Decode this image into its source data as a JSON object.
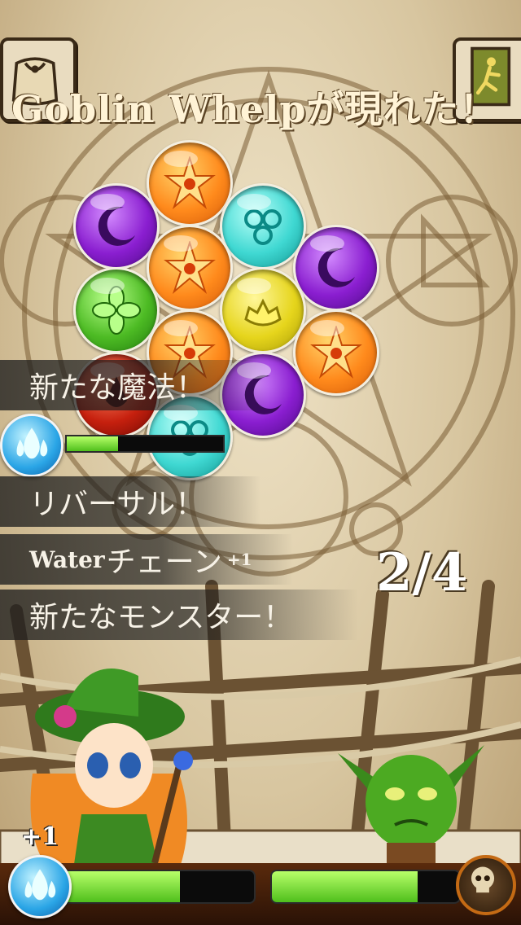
{
  "header": {
    "title": "Goblin Whelpが現れた！",
    "bag_icon": "bag-icon",
    "exit_icon": "running-man-exit-icon"
  },
  "board": {
    "orbs": [
      {
        "type": "fire"
      },
      {
        "type": "moon"
      },
      {
        "type": "water"
      },
      {
        "type": "fire"
      },
      {
        "type": "moon"
      },
      {
        "type": "leaf"
      },
      {
        "type": "earth"
      },
      {
        "type": "fire"
      },
      {
        "type": "fire"
      },
      {
        "type": "blood"
      },
      {
        "type": "moon"
      },
      {
        "type": "water"
      }
    ]
  },
  "log": {
    "new_spell": "新たな魔法！",
    "reversal": "リバーサル！",
    "chain_word": "Water",
    "chain_suffix": "チェーン",
    "chain_bonus": "+1",
    "new_monster": "新たなモンスター！"
  },
  "spell_progress": {
    "element": "water",
    "fraction": 0.33
  },
  "wave": {
    "counter": "2/4"
  },
  "battle": {
    "player_bonus": "+1",
    "player_hp": 0.62,
    "enemy_hp": 0.78
  },
  "colors": {
    "hp_green": "#6fd62b",
    "accent_water": "#2aa5e6",
    "parchment": "#e6d6b2"
  }
}
